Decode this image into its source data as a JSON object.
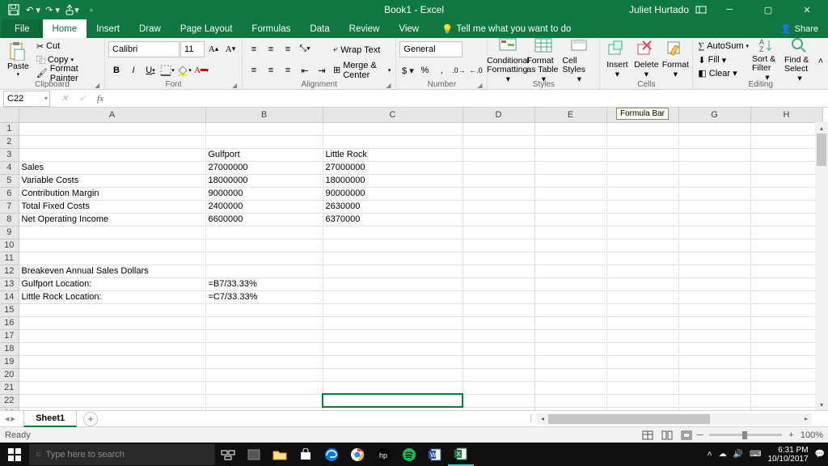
{
  "title_bar": {
    "app_title": "Book1 - Excel",
    "user": "Juliet Hurtado"
  },
  "ribbon_tabs": {
    "file": "File",
    "home": "Home",
    "insert": "Insert",
    "draw": "Draw",
    "page_layout": "Page Layout",
    "formulas": "Formulas",
    "data": "Data",
    "review": "Review",
    "view": "View",
    "tell_me": "Tell me what you want to do",
    "share": "Share"
  },
  "ribbon": {
    "clipboard": {
      "paste": "Paste",
      "cut": "Cut",
      "copy": "Copy",
      "painter": "Format Painter",
      "label": "Clipboard"
    },
    "font": {
      "name": "Calibri",
      "size": "11",
      "label": "Font"
    },
    "alignment": {
      "wrap": "Wrap Text",
      "merge": "Merge & Center",
      "label": "Alignment"
    },
    "number": {
      "format": "General",
      "label": "Number"
    },
    "styles": {
      "cond": "Conditional Formatting",
      "fat": "Format as Table",
      "cell": "Cell Styles",
      "label": "Styles"
    },
    "cells": {
      "insert": "Insert",
      "delete": "Delete",
      "format": "Format",
      "label": "Cells"
    },
    "editing": {
      "sum": "AutoSum",
      "fill": "Fill",
      "clear": "Clear",
      "sort": "Sort & Filter",
      "find": "Find & Select",
      "label": "Editing"
    }
  },
  "name_box": "C22",
  "formula_tooltip": "Formula Bar",
  "columns": [
    "A",
    "B",
    "C",
    "D",
    "E",
    "F",
    "G",
    "H"
  ],
  "rows": [
    {
      "r": 1,
      "A": "",
      "B": "",
      "C": ""
    },
    {
      "r": 2,
      "A": "",
      "B": "",
      "C": ""
    },
    {
      "r": 3,
      "A": "",
      "B": "Gulfport",
      "C": "Little Rock"
    },
    {
      "r": 4,
      "A": "Sales",
      "B": "27000000",
      "C": "27000000"
    },
    {
      "r": 5,
      "A": "Variable Costs",
      "B": "18000000",
      "C": "18000000"
    },
    {
      "r": 6,
      "A": "Contribution Margin",
      "B": "9000000",
      "C": "90000000"
    },
    {
      "r": 7,
      "A": "Total Fixed Costs",
      "B": "2400000",
      "C": "2630000"
    },
    {
      "r": 8,
      "A": "Net Operating Income",
      "B": "6600000",
      "C": "6370000"
    },
    {
      "r": 9,
      "A": "",
      "B": "",
      "C": ""
    },
    {
      "r": 10,
      "A": "",
      "B": "",
      "C": ""
    },
    {
      "r": 11,
      "A": "",
      "B": "",
      "C": ""
    },
    {
      "r": 12,
      "A": "Breakeven Annual Sales Dollars",
      "B": "",
      "C": ""
    },
    {
      "r": 13,
      "A": "Gulfport Location:",
      "B": "=B7/33.33%",
      "C": ""
    },
    {
      "r": 14,
      "A": "Little Rock Location:",
      "B": "=C7/33.33%",
      "C": ""
    },
    {
      "r": 15,
      "A": "",
      "B": "",
      "C": ""
    },
    {
      "r": 16,
      "A": "",
      "B": "",
      "C": ""
    },
    {
      "r": 17,
      "A": "",
      "B": "",
      "C": ""
    },
    {
      "r": 18,
      "A": "",
      "B": "",
      "C": ""
    },
    {
      "r": 19,
      "A": "",
      "B": "",
      "C": ""
    },
    {
      "r": 20,
      "A": "",
      "B": "",
      "C": ""
    },
    {
      "r": 21,
      "A": "",
      "B": "",
      "C": ""
    },
    {
      "r": 22,
      "A": "",
      "B": "",
      "C": ""
    },
    {
      "r": 23,
      "A": "",
      "B": "",
      "C": ""
    }
  ],
  "selected": {
    "row": 22,
    "col": "C"
  },
  "sheet_tab": "Sheet1",
  "status": {
    "ready": "Ready",
    "zoom": "100%"
  },
  "taskbar": {
    "search_placeholder": "Type here to search",
    "time": "6:31 PM",
    "date": "10/10/2017"
  }
}
